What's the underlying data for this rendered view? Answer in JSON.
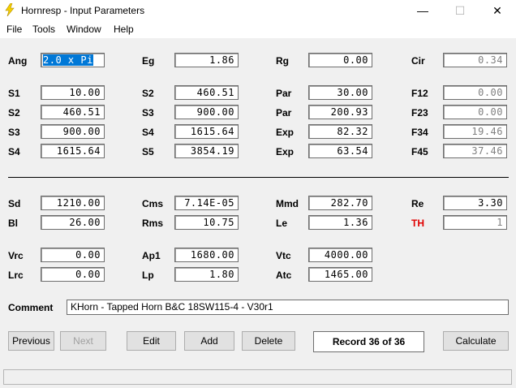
{
  "window": {
    "title": "Hornresp - Input Parameters",
    "minimize": "—",
    "maximize": "☐",
    "close": "✕"
  },
  "menu": [
    "File",
    "Tools",
    "Window",
    "Help"
  ],
  "params": {
    "ang": {
      "label": "Ang",
      "value": "2.0 x Pi"
    },
    "eg": {
      "label": "Eg",
      "value": "1.86"
    },
    "rg": {
      "label": "Rg",
      "value": "0.00"
    },
    "cir": {
      "label": "Cir",
      "value": "0.34"
    },
    "s1": {
      "label": "S1",
      "value": "10.00"
    },
    "s2a": {
      "label": "S2",
      "value": "460.51"
    },
    "par1": {
      "label": "Par",
      "value": "30.00"
    },
    "f12": {
      "label": "F12",
      "value": "0.00"
    },
    "s2b": {
      "label": "S2",
      "value": "460.51"
    },
    "s3a": {
      "label": "S3",
      "value": "900.00"
    },
    "par2": {
      "label": "Par",
      "value": "200.93"
    },
    "f23": {
      "label": "F23",
      "value": "0.00"
    },
    "s3b": {
      "label": "S3",
      "value": "900.00"
    },
    "s4a": {
      "label": "S4",
      "value": "1615.64"
    },
    "exp1": {
      "label": "Exp",
      "value": "82.32"
    },
    "f34": {
      "label": "F34",
      "value": "19.46"
    },
    "s4b": {
      "label": "S4",
      "value": "1615.64"
    },
    "s5": {
      "label": "S5",
      "value": "3854.19"
    },
    "exp2": {
      "label": "Exp",
      "value": "63.54"
    },
    "f45": {
      "label": "F45",
      "value": "37.46"
    },
    "sd": {
      "label": "Sd",
      "value": "1210.00"
    },
    "cms": {
      "label": "Cms",
      "value": "7.14E-05"
    },
    "mmd": {
      "label": "Mmd",
      "value": "282.70"
    },
    "re": {
      "label": "Re",
      "value": "3.30"
    },
    "bl": {
      "label": "Bl",
      "value": "26.00"
    },
    "rms": {
      "label": "Rms",
      "value": "10.75"
    },
    "le": {
      "label": "Le",
      "value": "1.36"
    },
    "th": {
      "label": "TH",
      "value": "1"
    },
    "vrc": {
      "label": "Vrc",
      "value": "0.00"
    },
    "ap1": {
      "label": "Ap1",
      "value": "1680.00"
    },
    "vtc": {
      "label": "Vtc",
      "value": "4000.00"
    },
    "lrc": {
      "label": "Lrc",
      "value": "0.00"
    },
    "lp": {
      "label": "Lp",
      "value": "1.80"
    },
    "atc": {
      "label": "Atc",
      "value": "1465.00"
    }
  },
  "comment": {
    "label": "Comment",
    "value": "KHorn - Tapped Horn B&C 18SW115-4 - V30r1"
  },
  "buttons": {
    "previous": "Previous",
    "next": "Next",
    "edit": "Edit",
    "add": "Add",
    "delete": "Delete",
    "calculate": "Calculate"
  },
  "record": "Record 36 of 36",
  "colors": {
    "selection": "#0078d7",
    "th_label": "#e00000"
  }
}
